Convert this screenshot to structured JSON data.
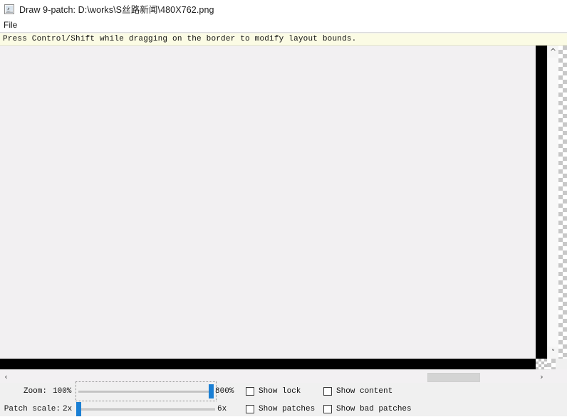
{
  "window": {
    "icon": "java-app-icon",
    "title": "Draw 9-patch: D:\\works\\S丝路新闻\\480X762.png"
  },
  "menubar": {
    "items": [
      {
        "label": "File"
      }
    ]
  },
  "hint": {
    "text": "Press Control/Shift while dragging on the border to modify layout bounds."
  },
  "scrollbars": {
    "vertical": {
      "up_icon": "chevron-up-icon",
      "down_icon": "chevron-down-icon"
    },
    "horizontal": {
      "left_icon": "chevron-left-icon",
      "right_icon": "chevron-right-icon"
    }
  },
  "controls": {
    "zoom": {
      "label": "Zoom:",
      "min_label": "100%",
      "max_label": "800%",
      "value_percent": 800,
      "focused": true
    },
    "patch_scale": {
      "label": "Patch scale:",
      "min_label": "2x",
      "max_label": "6x",
      "value_x": 2,
      "focused": false
    },
    "checkboxes": [
      {
        "name": "show-lock",
        "label": "Show lock",
        "checked": false
      },
      {
        "name": "show-content",
        "label": "Show content",
        "checked": false
      },
      {
        "name": "show-patches",
        "label": "Show patches",
        "checked": false
      },
      {
        "name": "show-bad-patches",
        "label": "Show bad patches",
        "checked": false
      }
    ]
  },
  "colors": {
    "accent": "#1a7fd4",
    "hint_background": "#fbfbe4",
    "canvas_background": "#f2f0f2",
    "patch_band": "#000000",
    "panel_background": "#f0f0f0"
  }
}
